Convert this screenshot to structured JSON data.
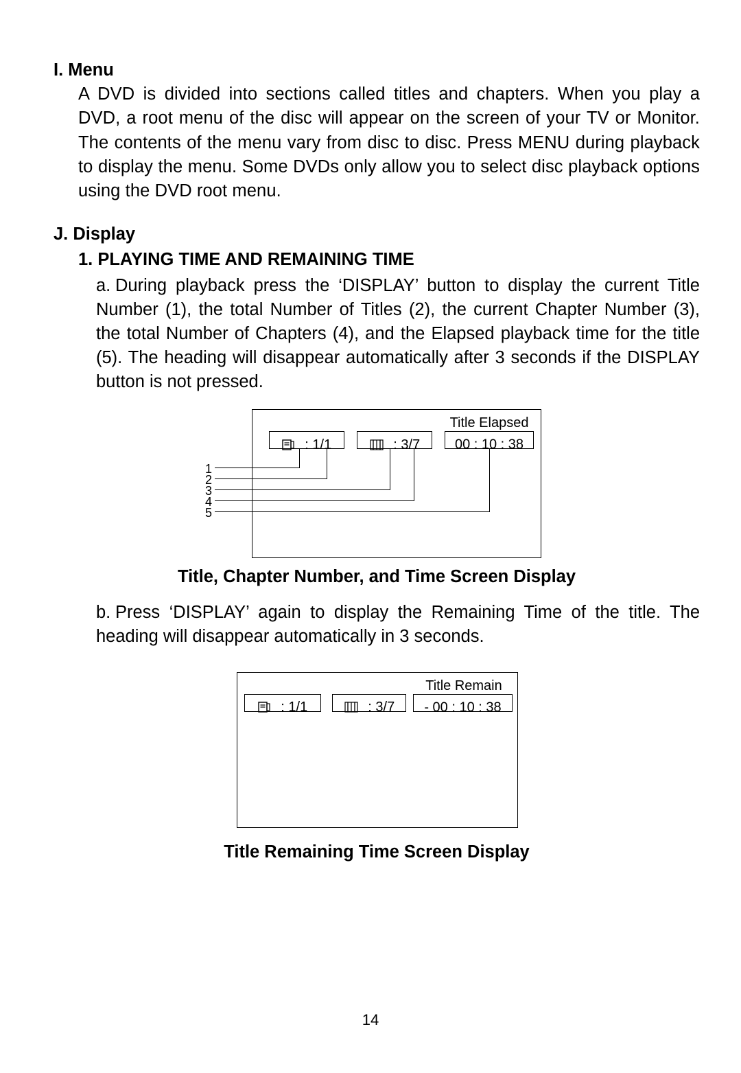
{
  "sections": {
    "i": {
      "heading": "I. Menu",
      "body": "A DVD is divided into sections called titles and chapters. When you play a DVD, a root menu of the disc will appear on the screen of your TV or Monitor. The contents of the menu vary from disc to disc. Press MENU during playback to display the menu. Some DVDs only allow you to select disc playback options using the DVD root menu."
    },
    "j": {
      "heading": "J. Display",
      "sub1": {
        "heading": "1. PLAYING TIME AND REMAINING TIME",
        "a_prefix": "a.",
        "a": "During playback press the ‘DISPLAY’  button to display the cur­rent Title Number (1), the total Number of Titles (2), the current Chapter Number (3), the total Number of Chapters (4), and the Elapsed playback time for the title (5). The heading will disappear automatically after 3 seconds if the DISPLAY button is not pressed.",
        "b_prefix": "b.",
        "b": "Press ‘DISPLAY’ again to display the Remaining Time of  the title. The heading will disappear automatically  in 3 seconds."
      }
    }
  },
  "figure1": {
    "topLabel": "Title  Elapsed",
    "title_ratio": " : 1/1",
    "chapter_ratio": " : 3/7",
    "time": "00 : 10 : 38",
    "callouts": [
      "1",
      "2",
      "3",
      "4",
      "5"
    ],
    "caption": "Title, Chapter Number, and Time Screen Display"
  },
  "figure2": {
    "topLabel": "Title  Remain",
    "title_ratio": " : 1/1",
    "chapter_ratio": " : 3/7",
    "time": "- 00 : 10 : 38",
    "caption": "Title Remaining Time Screen Display"
  },
  "pageNumber": "14"
}
